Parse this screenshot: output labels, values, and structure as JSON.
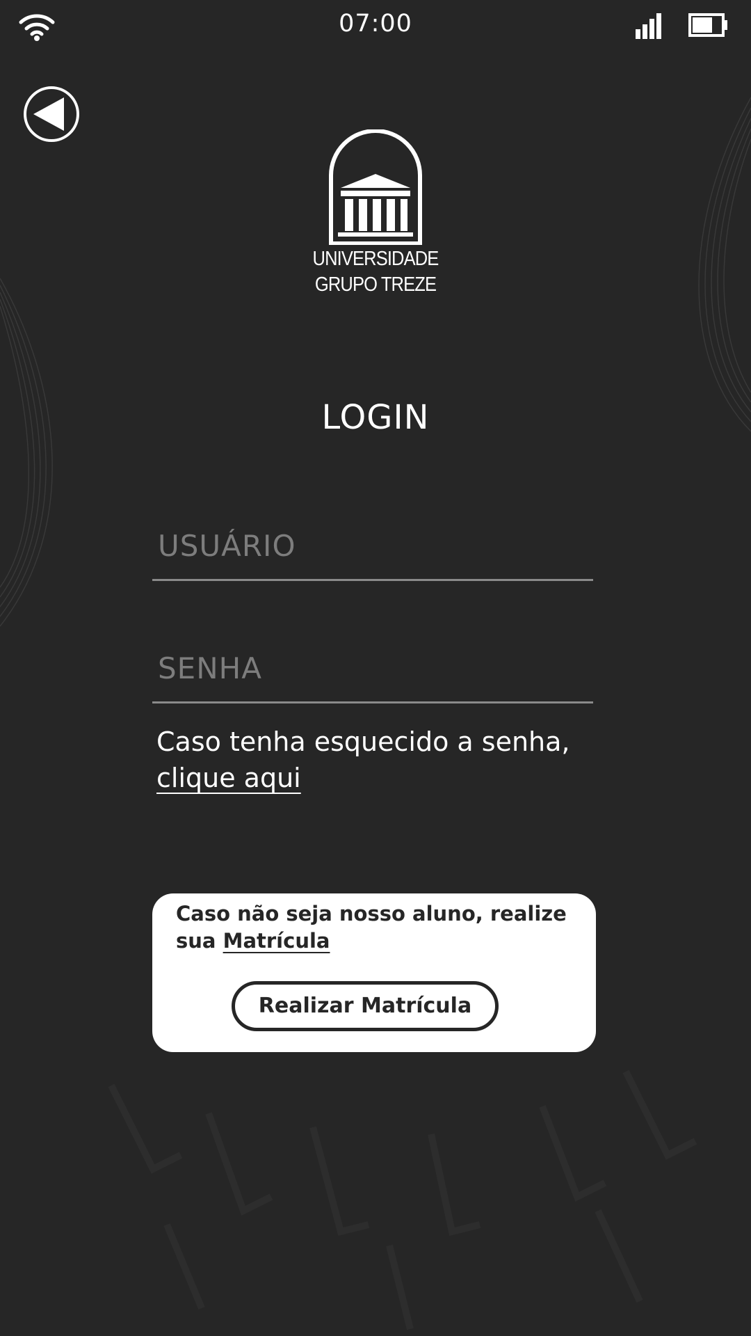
{
  "status_bar": {
    "time": "07:00",
    "wifi_icon": "wifi-icon",
    "signal_icon": "signal-icon",
    "battery_icon": "battery-icon"
  },
  "header": {
    "back_icon": "back-arrow-icon",
    "logo_icon": "university-building-icon",
    "logo_line1": "UNIVERSIDADE",
    "logo_line2": "GRUPO TREZE"
  },
  "login": {
    "title": "LOGIN",
    "username_placeholder": "USUÁRIO",
    "username_value": "",
    "password_placeholder": "SENHA",
    "password_value": "",
    "forgot_text": "Caso tenha esquecido a senha,",
    "forgot_link": "clique aqui"
  },
  "enroll_card": {
    "text": "Caso não seja nosso aluno, realize sua",
    "link": "Matrícula",
    "button_label": "Realizar Matrícula"
  },
  "colors": {
    "background": "#262626",
    "text": "#ffffff",
    "placeholder": "#7d7d7d",
    "card": "#ffffff"
  }
}
